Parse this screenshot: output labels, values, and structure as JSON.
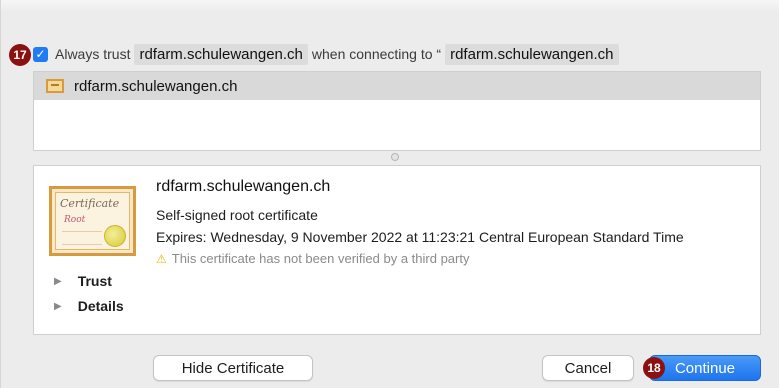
{
  "trust": {
    "step_badge": "17",
    "checkbox_mark": "✓",
    "prefix": "Always trust",
    "host": "rdfarm.schulewangen.ch",
    "middle": "when connecting to “",
    "host_repeat": "rdfarm.schulewangen.ch"
  },
  "certificate_list": {
    "items": [
      {
        "label": "rdfarm.schulewangen.ch"
      }
    ]
  },
  "certificate": {
    "image_title": "Certificate",
    "image_subtitle": "Root",
    "name": "rdfarm.schulewangen.ch",
    "kind": "Self-signed root certificate",
    "expires": "Expires: Wednesday, 9 November 2022 at 11:23:21 Central European Standard Time",
    "warning_icon": "⚠",
    "warning": "This certificate has not been verified by a third party",
    "sections": [
      {
        "label": "Trust"
      },
      {
        "label": "Details"
      }
    ],
    "disclosure_glyph": "▶"
  },
  "buttons": {
    "hide_certificate": "Hide Certificate",
    "cancel": "Cancel",
    "continue_step_badge": "18",
    "continue": "Continue"
  },
  "colors": {
    "accent": "#1f7cf3",
    "step_badge": "#8b1010",
    "warning": "#f0b400"
  }
}
